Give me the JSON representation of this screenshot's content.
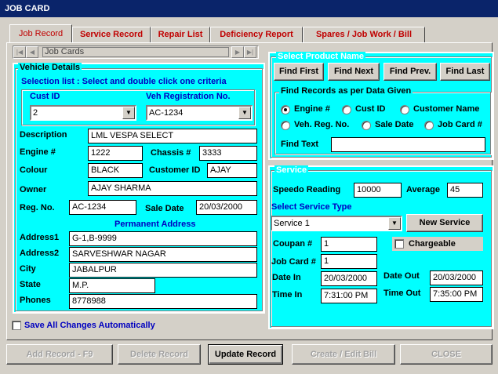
{
  "window": {
    "title": "JOB CARD"
  },
  "tabs": [
    {
      "label": "Job Record"
    },
    {
      "label": "Service Record"
    },
    {
      "label": "Repair List"
    },
    {
      "label": "Deficiency Report"
    },
    {
      "label": "Spares / Job Work / Bill"
    }
  ],
  "nav": {
    "text": "Job Cards",
    "first": "|◀",
    "prev": "◀",
    "next": "▶",
    "last": "▶|"
  },
  "vehicle": {
    "legend": "Vehicle Details",
    "selection_hint": "Selection list : Select and double click one criteria",
    "cust_id_label": "Cust ID",
    "cust_id_value": "2",
    "veh_reg_label": "Veh Registration No.",
    "veh_reg_value": "AC-1234",
    "description_label": "Description",
    "description": "LML VESPA SELECT",
    "engine_label": "Engine #",
    "engine": "1222",
    "chassis_label": "Chassis #",
    "chassis": "3333",
    "colour_label": "Colour",
    "colour": "BLACK",
    "customer_id_label": "Customer ID",
    "customer_id": "AJAY",
    "owner_label": "Owner",
    "owner": "AJAY SHARMA",
    "reg_no_label": "Reg. No.",
    "reg_no": "AC-1234",
    "sale_date_label": "Sale Date",
    "sale_date": "20/03/2000",
    "permanent_address_label": "Permanent Address",
    "address1_label": "Address1",
    "address1": "G-1,B-9999",
    "address2_label": "Address2",
    "address2": "SARVESHWAR NAGAR",
    "city_label": "City",
    "city": "JABALPUR",
    "state_label": "State",
    "state": "M.P.",
    "phones_label": "Phones",
    "phones": "8778988"
  },
  "save_all_label": "Save All Changes Automatically",
  "product": {
    "legend": "Select Product Name",
    "find_first": "Find First",
    "find_next": "Find Next",
    "find_prev": "Find Prev.",
    "find_last": "Find Last",
    "find_group_legend": "Find Records as per Data Given",
    "opt_engine": "Engine #",
    "opt_cust_id": "Cust ID",
    "opt_customer_name": "Customer Name",
    "opt_veh_reg": "Veh. Reg. No.",
    "opt_sale_date": "Sale Date",
    "opt_job_card": "Job Card #",
    "find_text_label": "Find Text",
    "find_text": ""
  },
  "service": {
    "legend": "Service",
    "speedo_label": "Speedo Reading",
    "speedo": "10000",
    "average_label": "Average",
    "average": "45",
    "type_label": "Select Service Type",
    "type_value": "Service 1",
    "new_service": "New Service",
    "coupan_label": "Coupan #",
    "coupan": "1",
    "chargeable_label": "Chargeable",
    "job_card_label": "Job Card #",
    "job_card": "1",
    "date_in_label": "Date In",
    "date_in": "20/03/2000",
    "date_out_label": "Date Out",
    "date_out": "20/03/2000",
    "time_in_label": "Time In",
    "time_in": "7:31:00 PM",
    "time_out_label": "Time Out",
    "time_out": "7:35:00 PM"
  },
  "footer": {
    "add_record": "Add Record - F9",
    "delete_record": "Delete Record",
    "update_record": "Update Record",
    "create_bill": "Create / Edit Bill",
    "close": "CLOSE"
  }
}
